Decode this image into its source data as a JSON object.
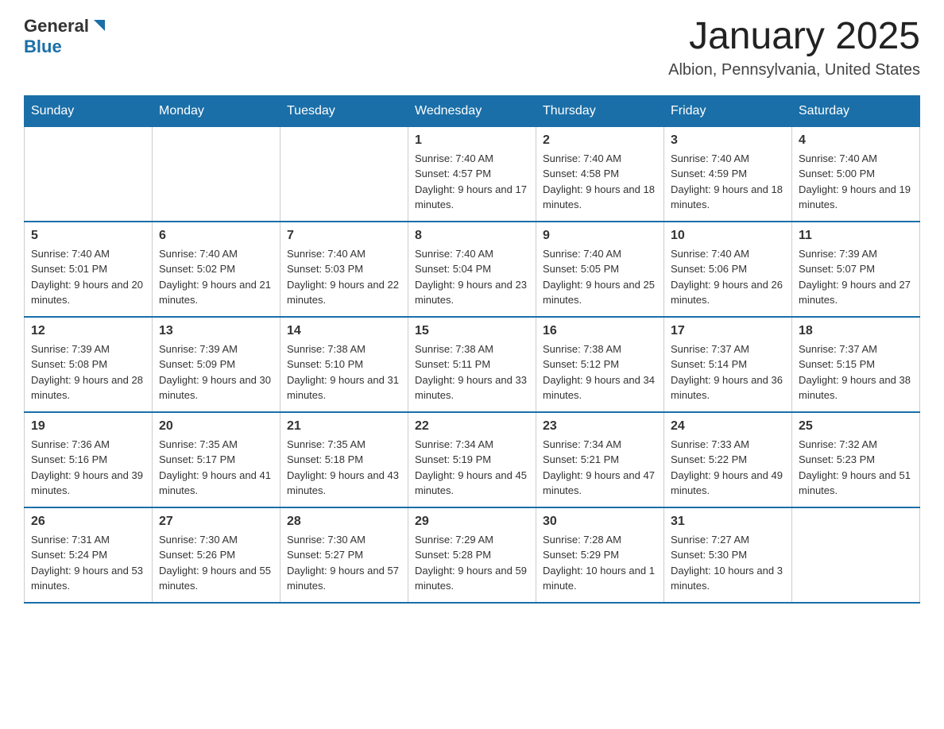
{
  "logo": {
    "general": "General",
    "blue": "Blue"
  },
  "header": {
    "title": "January 2025",
    "location": "Albion, Pennsylvania, United States"
  },
  "days_of_week": [
    "Sunday",
    "Monday",
    "Tuesday",
    "Wednesday",
    "Thursday",
    "Friday",
    "Saturday"
  ],
  "weeks": [
    [
      {
        "day": "",
        "info": ""
      },
      {
        "day": "",
        "info": ""
      },
      {
        "day": "",
        "info": ""
      },
      {
        "day": "1",
        "info": "Sunrise: 7:40 AM\nSunset: 4:57 PM\nDaylight: 9 hours and 17 minutes."
      },
      {
        "day": "2",
        "info": "Sunrise: 7:40 AM\nSunset: 4:58 PM\nDaylight: 9 hours and 18 minutes."
      },
      {
        "day": "3",
        "info": "Sunrise: 7:40 AM\nSunset: 4:59 PM\nDaylight: 9 hours and 18 minutes."
      },
      {
        "day": "4",
        "info": "Sunrise: 7:40 AM\nSunset: 5:00 PM\nDaylight: 9 hours and 19 minutes."
      }
    ],
    [
      {
        "day": "5",
        "info": "Sunrise: 7:40 AM\nSunset: 5:01 PM\nDaylight: 9 hours and 20 minutes."
      },
      {
        "day": "6",
        "info": "Sunrise: 7:40 AM\nSunset: 5:02 PM\nDaylight: 9 hours and 21 minutes."
      },
      {
        "day": "7",
        "info": "Sunrise: 7:40 AM\nSunset: 5:03 PM\nDaylight: 9 hours and 22 minutes."
      },
      {
        "day": "8",
        "info": "Sunrise: 7:40 AM\nSunset: 5:04 PM\nDaylight: 9 hours and 23 minutes."
      },
      {
        "day": "9",
        "info": "Sunrise: 7:40 AM\nSunset: 5:05 PM\nDaylight: 9 hours and 25 minutes."
      },
      {
        "day": "10",
        "info": "Sunrise: 7:40 AM\nSunset: 5:06 PM\nDaylight: 9 hours and 26 minutes."
      },
      {
        "day": "11",
        "info": "Sunrise: 7:39 AM\nSunset: 5:07 PM\nDaylight: 9 hours and 27 minutes."
      }
    ],
    [
      {
        "day": "12",
        "info": "Sunrise: 7:39 AM\nSunset: 5:08 PM\nDaylight: 9 hours and 28 minutes."
      },
      {
        "day": "13",
        "info": "Sunrise: 7:39 AM\nSunset: 5:09 PM\nDaylight: 9 hours and 30 minutes."
      },
      {
        "day": "14",
        "info": "Sunrise: 7:38 AM\nSunset: 5:10 PM\nDaylight: 9 hours and 31 minutes."
      },
      {
        "day": "15",
        "info": "Sunrise: 7:38 AM\nSunset: 5:11 PM\nDaylight: 9 hours and 33 minutes."
      },
      {
        "day": "16",
        "info": "Sunrise: 7:38 AM\nSunset: 5:12 PM\nDaylight: 9 hours and 34 minutes."
      },
      {
        "day": "17",
        "info": "Sunrise: 7:37 AM\nSunset: 5:14 PM\nDaylight: 9 hours and 36 minutes."
      },
      {
        "day": "18",
        "info": "Sunrise: 7:37 AM\nSunset: 5:15 PM\nDaylight: 9 hours and 38 minutes."
      }
    ],
    [
      {
        "day": "19",
        "info": "Sunrise: 7:36 AM\nSunset: 5:16 PM\nDaylight: 9 hours and 39 minutes."
      },
      {
        "day": "20",
        "info": "Sunrise: 7:35 AM\nSunset: 5:17 PM\nDaylight: 9 hours and 41 minutes."
      },
      {
        "day": "21",
        "info": "Sunrise: 7:35 AM\nSunset: 5:18 PM\nDaylight: 9 hours and 43 minutes."
      },
      {
        "day": "22",
        "info": "Sunrise: 7:34 AM\nSunset: 5:19 PM\nDaylight: 9 hours and 45 minutes."
      },
      {
        "day": "23",
        "info": "Sunrise: 7:34 AM\nSunset: 5:21 PM\nDaylight: 9 hours and 47 minutes."
      },
      {
        "day": "24",
        "info": "Sunrise: 7:33 AM\nSunset: 5:22 PM\nDaylight: 9 hours and 49 minutes."
      },
      {
        "day": "25",
        "info": "Sunrise: 7:32 AM\nSunset: 5:23 PM\nDaylight: 9 hours and 51 minutes."
      }
    ],
    [
      {
        "day": "26",
        "info": "Sunrise: 7:31 AM\nSunset: 5:24 PM\nDaylight: 9 hours and 53 minutes."
      },
      {
        "day": "27",
        "info": "Sunrise: 7:30 AM\nSunset: 5:26 PM\nDaylight: 9 hours and 55 minutes."
      },
      {
        "day": "28",
        "info": "Sunrise: 7:30 AM\nSunset: 5:27 PM\nDaylight: 9 hours and 57 minutes."
      },
      {
        "day": "29",
        "info": "Sunrise: 7:29 AM\nSunset: 5:28 PM\nDaylight: 9 hours and 59 minutes."
      },
      {
        "day": "30",
        "info": "Sunrise: 7:28 AM\nSunset: 5:29 PM\nDaylight: 10 hours and 1 minute."
      },
      {
        "day": "31",
        "info": "Sunrise: 7:27 AM\nSunset: 5:30 PM\nDaylight: 10 hours and 3 minutes."
      },
      {
        "day": "",
        "info": ""
      }
    ]
  ]
}
